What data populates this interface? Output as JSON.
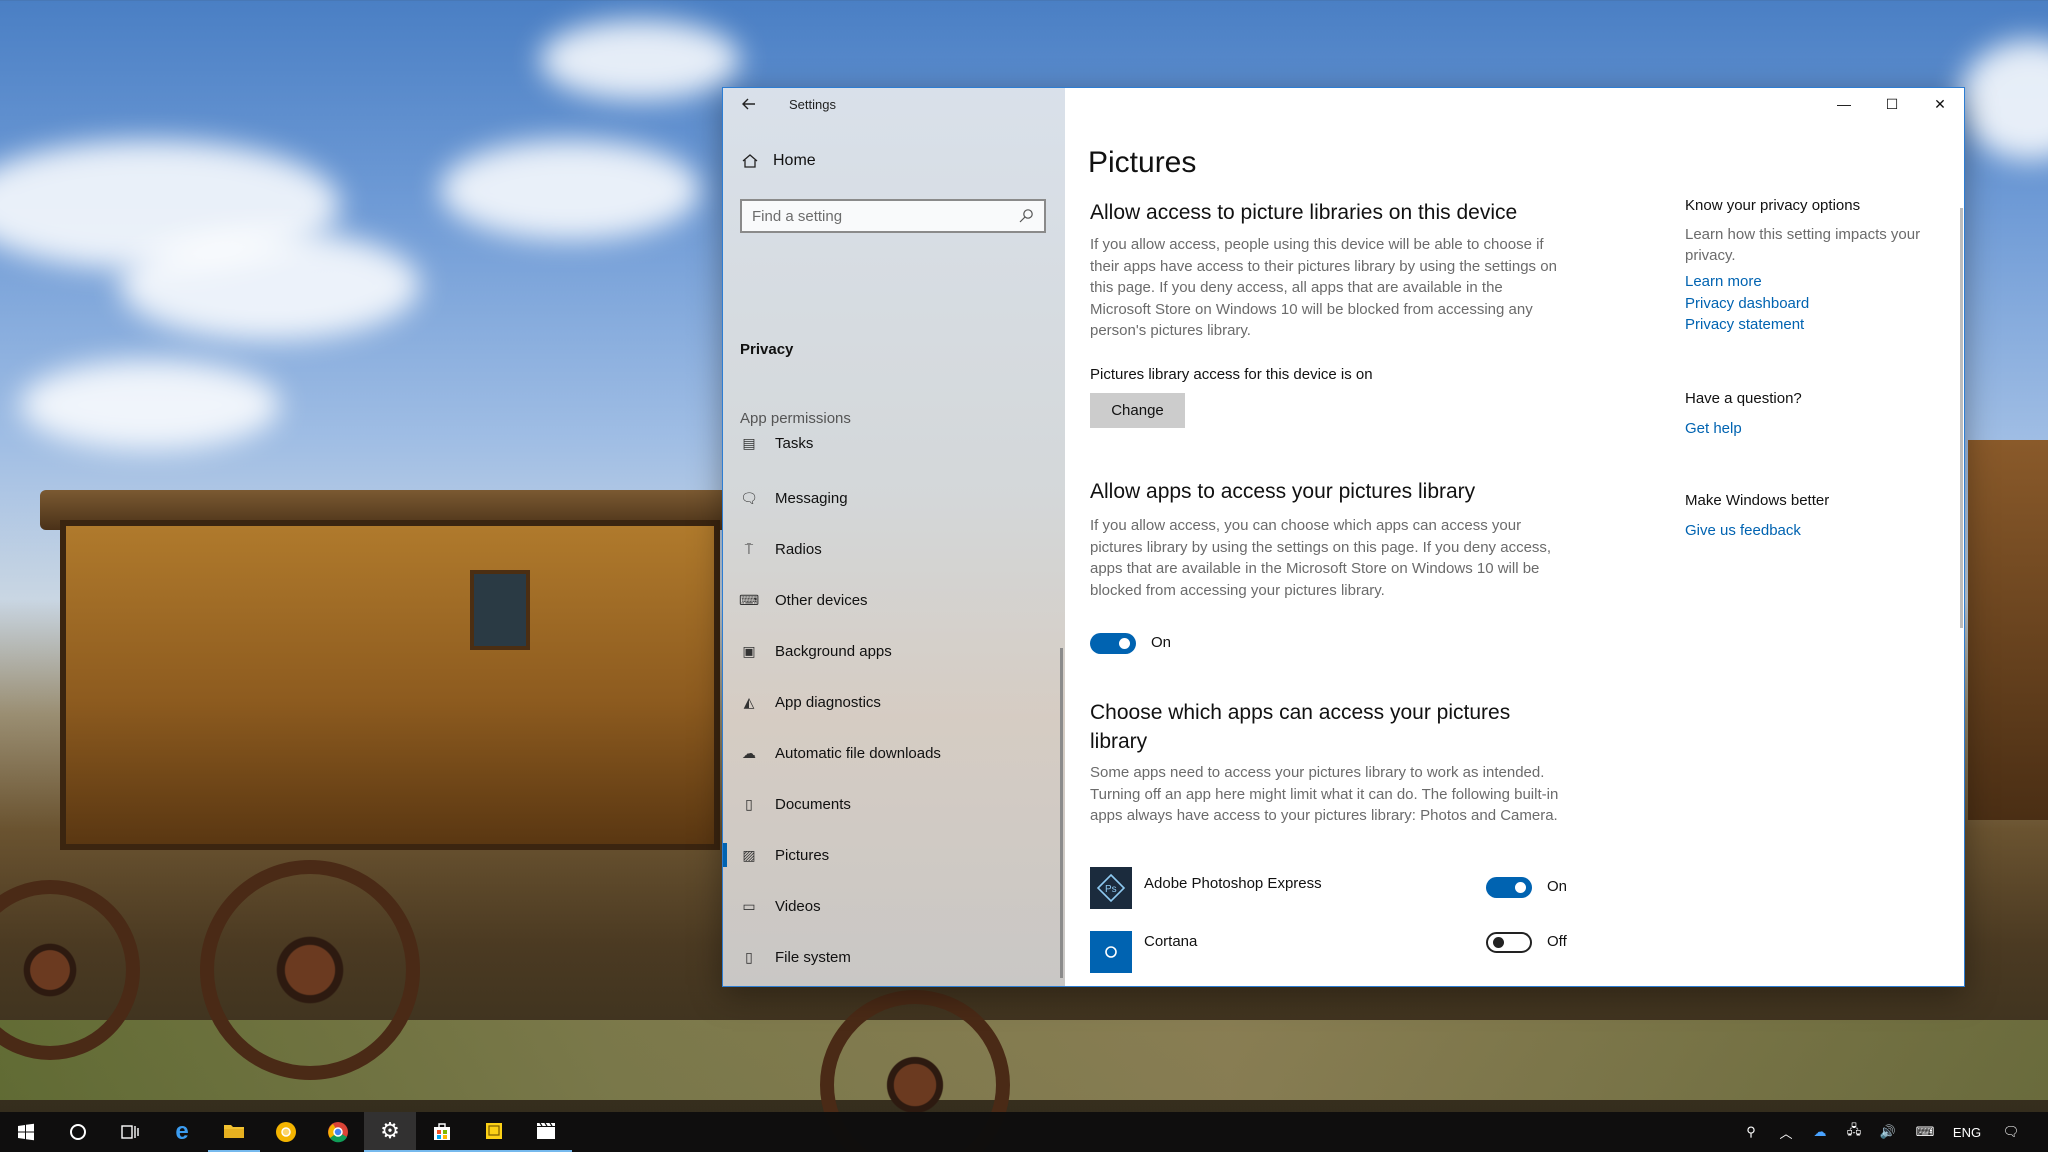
{
  "window": {
    "title": "Settings",
    "controls": {
      "minimize": "—",
      "maximize": "☐",
      "close": "✕"
    }
  },
  "sidebar": {
    "home": "Home",
    "search_placeholder": "Find a setting",
    "section": "Privacy",
    "group_label": "App permissions",
    "items": [
      {
        "label": "Tasks",
        "icon": "tasks-icon"
      },
      {
        "label": "Messaging",
        "icon": "chat-icon"
      },
      {
        "label": "Radios",
        "icon": "radio-tower-icon"
      },
      {
        "label": "Other devices",
        "icon": "devices-icon"
      },
      {
        "label": "Background apps",
        "icon": "background-apps-icon"
      },
      {
        "label": "App diagnostics",
        "icon": "diagnostics-icon"
      },
      {
        "label": "Automatic file downloads",
        "icon": "cloud-icon"
      },
      {
        "label": "Documents",
        "icon": "document-icon"
      },
      {
        "label": "Pictures",
        "icon": "pictures-icon"
      },
      {
        "label": "Videos",
        "icon": "video-icon"
      },
      {
        "label": "File system",
        "icon": "file-icon"
      }
    ],
    "active_item": "Pictures"
  },
  "main": {
    "title": "Pictures",
    "section1": {
      "heading": "Allow access to picture libraries on this device",
      "body": "If you allow access, people using this device will be able to choose if their apps have access to their pictures library by using the settings on this page. If you deny access, all apps that are available in the Microsoft Store on Windows 10 will be blocked from accessing any person's pictures library.",
      "status": "Pictures library access for this device is on",
      "button": "Change"
    },
    "section2": {
      "heading": "Allow apps to access your pictures library",
      "body": "If you allow access, you can choose which apps can access your pictures library by using the settings on this page. If you deny access, apps that are available in the Microsoft Store on Windows 10 will be blocked from accessing your pictures library.",
      "toggle_label": "On"
    },
    "section3": {
      "heading": "Choose which apps can access your pictures library",
      "body": "Some apps need to access your pictures library to work as intended. Turning off an app here might limit what it can do. The following built-in apps always have access to your pictures library: Photos and Camera.",
      "apps": [
        {
          "name": "Adobe Photoshop Express",
          "state": "On",
          "icon": "photoshop-express-icon",
          "icon_color": "#1b2b3d"
        },
        {
          "name": "Cortana",
          "state": "Off",
          "icon": "cortana-icon",
          "icon_color": "#0063b1"
        }
      ]
    }
  },
  "right_column": {
    "privacy_heading": "Know your privacy options",
    "privacy_body": "Learn how this setting impacts your privacy.",
    "links": [
      "Learn more",
      "Privacy dashboard",
      "Privacy statement"
    ],
    "question_heading": "Have a question?",
    "help_link": "Get help",
    "feedback_heading": "Make Windows better",
    "feedback_link": "Give us feedback"
  },
  "taskbar": {
    "apps": [
      "start-icon",
      "cortana-search-icon",
      "task-view-icon",
      "edge-icon",
      "file-explorer-icon",
      "chrome-canary-icon",
      "chrome-icon",
      "settings-icon",
      "store-icon",
      "sticky-notes-icon",
      "movies-icon"
    ],
    "language": "ENG"
  },
  "colors": {
    "accent": "#0063b1",
    "window_border": "#2d7dd2",
    "taskbar": "#0e0e0e"
  }
}
